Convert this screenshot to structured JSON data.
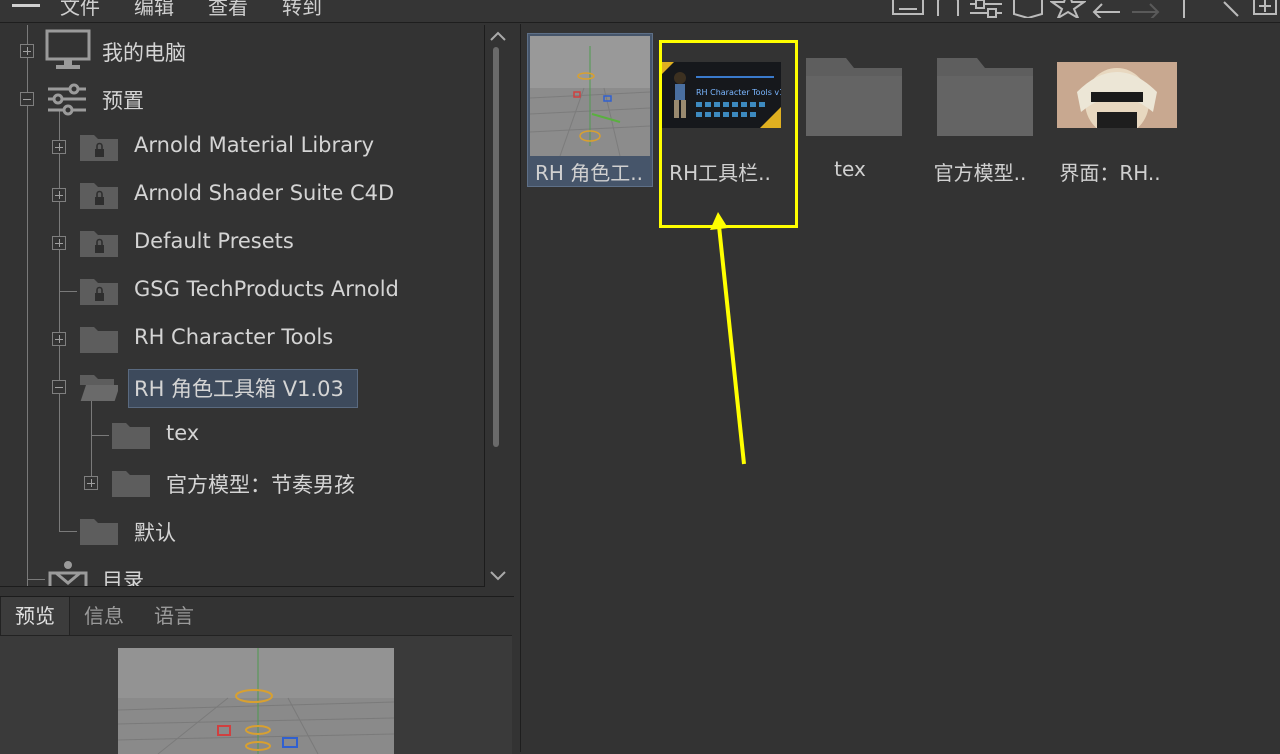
{
  "menubar": {
    "items": [
      "文件",
      "编辑",
      "查看",
      "转到"
    ]
  },
  "tree": {
    "nodes": [
      {
        "label": "我的电脑",
        "icon": "monitor-icon"
      },
      {
        "label": "预置",
        "icon": "sliders-icon"
      },
      {
        "label": "Arnold Material Library",
        "icon": "locked-folder-icon"
      },
      {
        "label": "Arnold Shader Suite C4D",
        "icon": "locked-folder-icon"
      },
      {
        "label": "Default Presets",
        "icon": "locked-folder-icon"
      },
      {
        "label": "GSG TechProducts Arnold",
        "icon": "locked-folder-icon"
      },
      {
        "label": "RH Character Tools",
        "icon": "folder-icon"
      },
      {
        "label": "RH 角色工具箱 V1.03",
        "icon": "open-folder-icon",
        "selected": true
      },
      {
        "label": "tex",
        "icon": "folder-icon"
      },
      {
        "label": "官方模型：节奏男孩",
        "icon": "folder-icon"
      },
      {
        "label": "默认",
        "icon": "folder-icon"
      },
      {
        "label": "目录",
        "icon": "catalog-icon"
      }
    ]
  },
  "bottom_tabs": [
    "预览",
    "信息",
    "语言"
  ],
  "active_bottom_tab": "预览",
  "content": {
    "items": [
      {
        "label": "RH 角色工..",
        "type": "scene-thumbnail",
        "selected": true
      },
      {
        "label": "RH工具栏..",
        "type": "banner-thumbnail",
        "highlighted": true
      },
      {
        "label": "tex",
        "type": "folder"
      },
      {
        "label": "官方模型..",
        "type": "folder"
      },
      {
        "label": "界面：RH..",
        "type": "portrait-thumbnail"
      }
    ],
    "banner_text": "RH Character Tools v1.0"
  },
  "annotation": {
    "color": "#ffff00"
  }
}
